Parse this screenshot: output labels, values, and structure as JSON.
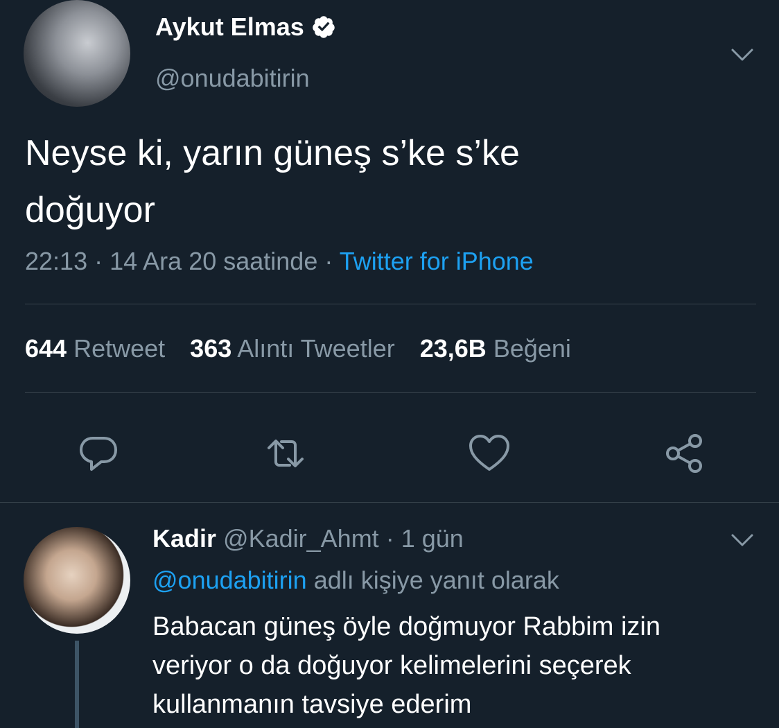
{
  "tweet": {
    "author_name": "Aykut Elmas",
    "handle": "@onudabitirin",
    "text_line1": "Neyse ki, yarın güneş s’ke s’ke",
    "text_line2": "doğuyor",
    "time": "22:13",
    "date_suffix": "14 Ara 20 saatinde",
    "source": "Twitter for iPhone",
    "stats": {
      "retweets_count": "644",
      "retweets_label": "Retweet",
      "quotes_count": "363",
      "quotes_label": "Alıntı Tweetler",
      "likes_count": "23,6B",
      "likes_label": "Beğeni"
    },
    "actions": [
      "reply-icon",
      "retweet-icon",
      "like-icon",
      "share-icon"
    ]
  },
  "reply": {
    "name": "Kadir",
    "handle": "@Kadir_Ahmt",
    "time": "1 gün",
    "replying_mention": "@onudabitirin",
    "replying_suffix": "adlı kişiye yanıt olarak",
    "line1": "Babacan güneş öyle doğmuyor Rabbim izin",
    "line2": "veriyor o da doğuyor kelimelerini seçerek",
    "line3": "kullanmanın tavsiye ederim"
  },
  "colors": {
    "background": "#15202b",
    "secondary_text": "#8899a6",
    "link": "#1da1f2",
    "divider": "#38444d"
  }
}
